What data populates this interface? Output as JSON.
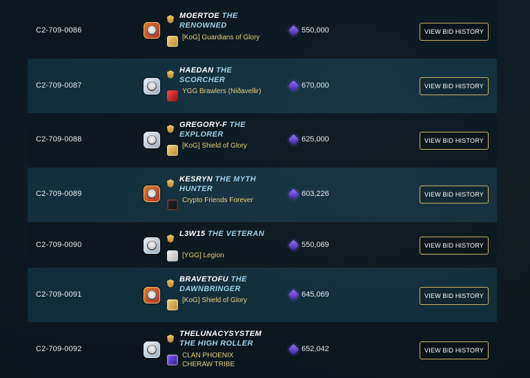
{
  "rows": [
    {
      "card_id": "C2-709-0086",
      "player_name": "MOERTOE",
      "player_title": "THE RENOWNED",
      "guild": "[KoG] Guardians of Glory",
      "bid": "550,000",
      "button_label": "VIEW BID HISTORY",
      "portrait_style": "fire",
      "guild_icon": "gold-crest-icon"
    },
    {
      "card_id": "C2-709-0087",
      "player_name": "HAEDAN",
      "player_title": "THE SCORCHER",
      "guild": "YGG Brawlers (Niðavellir)",
      "bid": "670,000",
      "button_label": "VIEW BID HISTORY",
      "portrait_style": "white",
      "guild_icon": "red-crest-icon"
    },
    {
      "card_id": "C2-709-0088",
      "player_name": "GREGORY-F",
      "player_title": "THE EXPLORER",
      "guild": "[KoG] Shield of Glory",
      "bid": "625,000",
      "button_label": "VIEW BID HISTORY",
      "portrait_style": "white",
      "guild_icon": "gold-crest-icon"
    },
    {
      "card_id": "C2-709-0089",
      "player_name": "KESRYN",
      "player_title": "THE MYTH HUNTER",
      "guild": "Crypto Friends Forever",
      "bid": "603,226",
      "button_label": "VIEW BID HISTORY",
      "portrait_style": "fire",
      "guild_icon": "dark-crest-icon"
    },
    {
      "card_id": "C2-709-0090",
      "player_name": "L3W15",
      "player_title": "THE VETERAN",
      "guild": "[YGG] Legion",
      "bid": "550,069",
      "button_label": "VIEW BID HISTORY",
      "portrait_style": "white",
      "guild_icon": "white-crest-icon"
    },
    {
      "card_id": "C2-709-0091",
      "player_name": "BRAVETOFU",
      "player_title": "THE DAWNBRINGER",
      "guild": "[KoG] Shield of Glory",
      "bid": "645,069",
      "button_label": "VIEW BID HISTORY",
      "portrait_style": "fire",
      "guild_icon": "gold-crest-icon"
    },
    {
      "card_id": "C2-709-0092",
      "player_name": "THELUNACYSYSTEM",
      "player_title": "THE HIGH ROLLER",
      "guild": "CLAN PHOENIX CHERAW TRIBE",
      "bid": "652,042",
      "button_label": "VIEW BID HISTORY",
      "portrait_style": "white",
      "guild_icon": "purple-crest-icon"
    }
  ],
  "colors": {
    "button_border": "#d1b46a",
    "guild_text": "#e9cf7f",
    "title_text": "#9fd0e8"
  }
}
